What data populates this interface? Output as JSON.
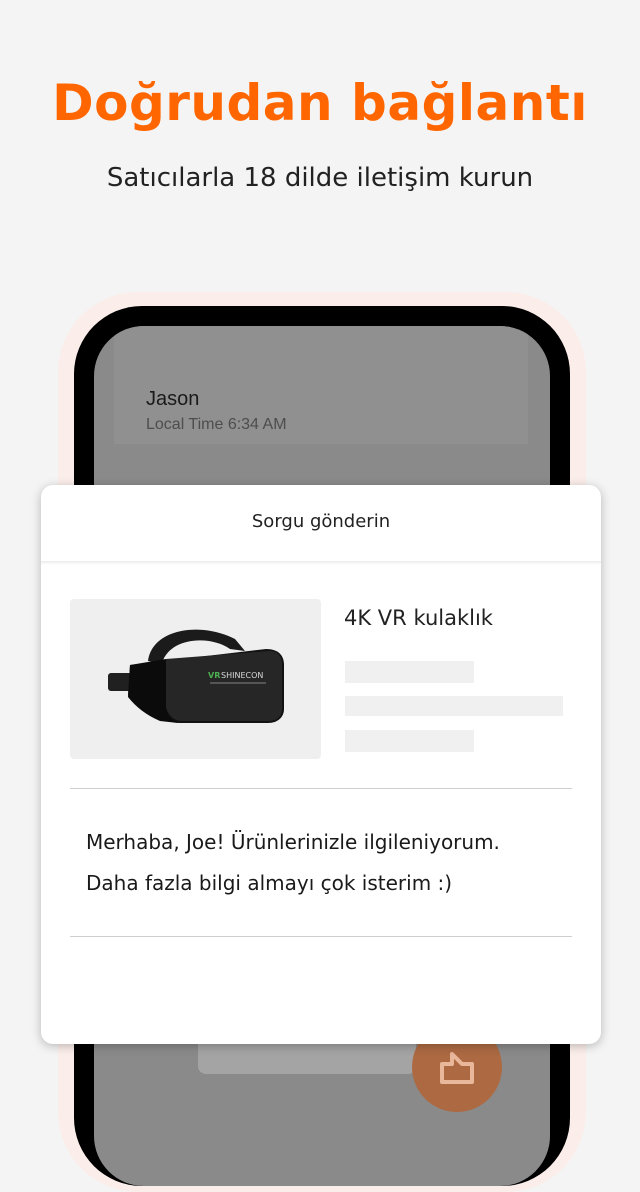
{
  "promo": {
    "headline": "Doğrudan bağlantı",
    "subline": "Satıcılarla 18 dilde iletişim kurun"
  },
  "chat": {
    "contact_name": "Jason",
    "local_time": "Local Time 6:34 AM"
  },
  "inquiry": {
    "title": "Sorgu gönderin",
    "product_title": "4K VR kulaklık",
    "product_image_brand": "VR SHINECON",
    "message_lines": [
      "Merhaba, Joe! Ürünlerinizle ilgileniyorum.",
      "Daha fazla bilgi almayı çok isterim :)"
    ]
  },
  "colors": {
    "accent": "#ff6600",
    "send_button": "#ad6a42"
  },
  "icons": {
    "send": "send-icon"
  }
}
